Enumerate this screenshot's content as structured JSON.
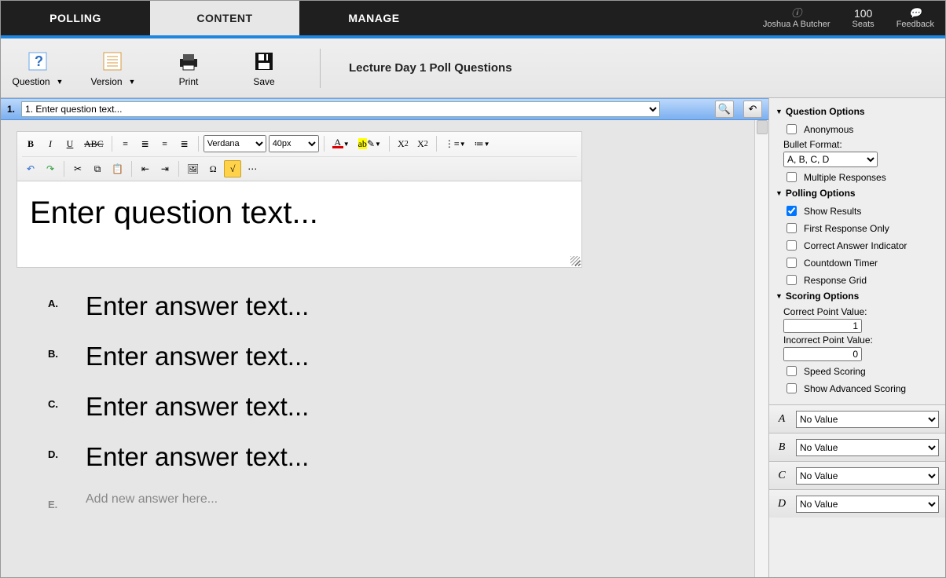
{
  "topnav": {
    "tabs": [
      "POLLING",
      "CONTENT",
      "MANAGE"
    ],
    "active": 1,
    "user": "Joshua A Butcher",
    "seats_count": "100",
    "seats_label": "Seats",
    "feedback": "Feedback"
  },
  "ribbon": {
    "question": "Question",
    "version": "Version",
    "print": "Print",
    "save": "Save",
    "title": "Lecture Day 1 Poll Questions"
  },
  "qbar": {
    "number": "1.",
    "options": [
      "1. Enter question text..."
    ],
    "selected": "1. Enter question text..."
  },
  "editor": {
    "font_family": "Verdana",
    "font_size": "40px",
    "question_text": "Enter question text..."
  },
  "answers": [
    {
      "label": "A.",
      "text": "Enter answer text..."
    },
    {
      "label": "B.",
      "text": "Enter answer text..."
    },
    {
      "label": "C.",
      "text": "Enter answer text..."
    },
    {
      "label": "D.",
      "text": "Enter answer text..."
    }
  ],
  "new_answer": {
    "label": "E.",
    "text": "Add new answer here..."
  },
  "options": {
    "question_header": "Question Options",
    "anonymous": "Anonymous",
    "bullet_label": "Bullet Format:",
    "bullet_value": "A, B, C, D",
    "multiple": "Multiple Responses",
    "polling_header": "Polling Options",
    "show_results": "Show Results",
    "first_response": "First Response Only",
    "correct_indicator": "Correct Answer Indicator",
    "countdown": "Countdown Timer",
    "response_grid": "Response Grid",
    "scoring_header": "Scoring Options",
    "correct_pv_label": "Correct Point Value:",
    "correct_pv": "1",
    "incorrect_pv_label": "Incorrect Point Value:",
    "incorrect_pv": "0",
    "speed": "Speed Scoring",
    "advanced": "Show Advanced Scoring",
    "no_value": "No Value"
  },
  "value_rows": [
    "A",
    "B",
    "C",
    "D"
  ]
}
